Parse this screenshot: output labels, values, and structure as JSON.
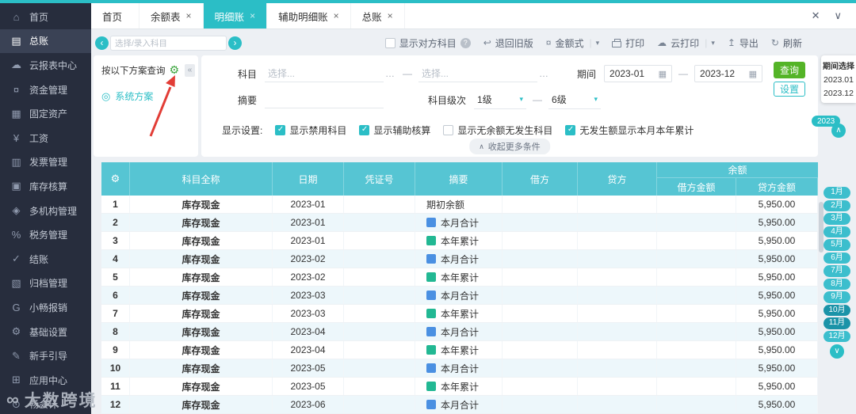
{
  "window": {
    "close_icon": "✕",
    "collapse_icon": "∨"
  },
  "tabs": {
    "items": [
      {
        "label": "首页",
        "close": "",
        "cls": "tab"
      },
      {
        "label": "余额表",
        "close": "×",
        "cls": "tab"
      },
      {
        "label": "明细账",
        "close": "×",
        "cls": "tab active"
      },
      {
        "label": "辅助明细账",
        "close": "×",
        "cls": "tab"
      },
      {
        "label": "总账",
        "close": "×",
        "cls": "tab"
      }
    ]
  },
  "sidebar": {
    "items": [
      {
        "label": "首页",
        "icon": "home-icon",
        "glyph": "⌂",
        "cls": "side-item"
      },
      {
        "label": "总账",
        "icon": "general-ledger-icon",
        "glyph": "▤",
        "cls": "side-item active"
      },
      {
        "label": "云报表中心",
        "icon": "cloud-report-icon",
        "glyph": "☁",
        "cls": "side-item"
      },
      {
        "label": "资金管理",
        "icon": "funds-icon",
        "glyph": "¤",
        "cls": "side-item"
      },
      {
        "label": "固定资产",
        "icon": "fixed-assets-icon",
        "glyph": "▦",
        "cls": "side-item"
      },
      {
        "label": "工资",
        "icon": "salary-icon",
        "glyph": "¥",
        "cls": "side-item"
      },
      {
        "label": "发票管理",
        "icon": "invoice-icon",
        "glyph": "▥",
        "cls": "side-item"
      },
      {
        "label": "库存核算",
        "icon": "inventory-icon",
        "glyph": "▣",
        "cls": "side-item"
      },
      {
        "label": "多机构管理",
        "icon": "multi-org-icon",
        "glyph": "◈",
        "cls": "side-item"
      },
      {
        "label": "税务管理",
        "icon": "tax-icon",
        "glyph": "%",
        "cls": "side-item"
      },
      {
        "label": "结账",
        "icon": "closing-icon",
        "glyph": "✓",
        "cls": "side-item"
      },
      {
        "label": "归档管理",
        "icon": "archive-icon",
        "glyph": "▧",
        "cls": "side-item"
      },
      {
        "label": "小畅报销",
        "icon": "reimburse-icon",
        "glyph": "G",
        "cls": "side-item"
      },
      {
        "label": "基础设置",
        "icon": "settings-icon",
        "glyph": "⚙",
        "cls": "side-item"
      },
      {
        "label": "新手引导",
        "icon": "guide-icon",
        "glyph": "✎",
        "cls": "side-item"
      },
      {
        "label": "应用中心",
        "icon": "app-center-icon",
        "glyph": "⊞",
        "cls": "side-item"
      },
      {
        "label": "畅会计",
        "icon": "accounting-icon",
        "glyph": "⊙",
        "cls": "side-item"
      }
    ]
  },
  "subject_search": {
    "prev": "‹",
    "next": "›",
    "placeholder": "选择/录入科目"
  },
  "toolbar": {
    "show_opposite": {
      "checked": false,
      "label": "显示对方科目",
      "help": "?"
    },
    "separator": "|",
    "caret": "▾",
    "items": [
      {
        "glyph": "↩",
        "label": "退回旧版"
      },
      {
        "glyph": "¤",
        "label": "金额式"
      },
      {
        "glyph": "",
        "label": "打印"
      },
      {
        "glyph": "☁",
        "label": "云打印"
      },
      {
        "glyph": "↥",
        "label": "导出"
      },
      {
        "glyph": "↻",
        "label": "刷新"
      }
    ]
  },
  "scheme": {
    "title": "按以下方案查询",
    "gear": "⚙",
    "collapse": "«",
    "item_icon": "◎",
    "item": "系统方案"
  },
  "filters": {
    "subject_label": "科目",
    "placeholder_from": "选择...",
    "placeholder_to": "选择...",
    "more": "…",
    "dash": "—",
    "period_label": "期间",
    "period_from": "2023-01",
    "period_to": "2023-12",
    "calendar": "▦",
    "summary_label": "摘要",
    "level_label": "科目级次",
    "level_from": "1级",
    "level_to": "6级",
    "caret": "▾",
    "query_btn": "查询",
    "settings_btn": "设置",
    "display_label": "显示设置:",
    "checks": [
      {
        "label": "显示禁用科目",
        "checked": true
      },
      {
        "label": "显示辅助核算",
        "checked": true
      },
      {
        "label": "显示无余额无发生科目",
        "checked": false
      },
      {
        "label": "无发生额显示本月本年累计",
        "checked": true
      }
    ],
    "collapse_icon": "∧",
    "collapse_more": "收起更多条件"
  },
  "period": {
    "title": "期间选择",
    "from": "2023.01",
    "to": "2023.12",
    "year": "2023",
    "up": "∧",
    "down": "∨",
    "months": [
      {
        "label": "1月",
        "cls": "month-pill"
      },
      {
        "label": "2月",
        "cls": "month-pill"
      },
      {
        "label": "3月",
        "cls": "month-pill"
      },
      {
        "label": "4月",
        "cls": "month-pill"
      },
      {
        "label": "5月",
        "cls": "month-pill"
      },
      {
        "label": "6月",
        "cls": "month-pill"
      },
      {
        "label": "7月",
        "cls": "month-pill"
      },
      {
        "label": "8月",
        "cls": "month-pill"
      },
      {
        "label": "9月",
        "cls": "month-pill"
      },
      {
        "label": "10月",
        "cls": "month-pill dark"
      },
      {
        "label": "11月",
        "cls": "month-pill dark"
      },
      {
        "label": "12月",
        "cls": "month-pill"
      }
    ]
  },
  "table": {
    "gear": "⚙",
    "headers": {
      "subject": "科目全称",
      "date": "日期",
      "voucher": "凭证号",
      "summary": "摘要",
      "debit": "借方",
      "credit": "贷方",
      "balance": "余额",
      "balance_debit": "借方金额",
      "balance_credit": "贷方金额"
    },
    "rows": [
      {
        "n": "1",
        "subject": "库存现金",
        "date": "2023-01",
        "voucher": "",
        "summary": "期初余额",
        "icon": "none",
        "debit": "",
        "credit": "",
        "bal_debit": "",
        "bal_credit": "5,950.00"
      },
      {
        "n": "2",
        "subject": "库存现金",
        "date": "2023-01",
        "voucher": "",
        "summary": "本月合计",
        "icon": "month",
        "debit": "",
        "credit": "",
        "bal_debit": "",
        "bal_credit": "5,950.00"
      },
      {
        "n": "3",
        "subject": "库存现金",
        "date": "2023-01",
        "voucher": "",
        "summary": "本年累计",
        "icon": "year",
        "debit": "",
        "credit": "",
        "bal_debit": "",
        "bal_credit": "5,950.00"
      },
      {
        "n": "4",
        "subject": "库存现金",
        "date": "2023-02",
        "voucher": "",
        "summary": "本月合计",
        "icon": "month",
        "debit": "",
        "credit": "",
        "bal_debit": "",
        "bal_credit": "5,950.00"
      },
      {
        "n": "5",
        "subject": "库存现金",
        "date": "2023-02",
        "voucher": "",
        "summary": "本年累计",
        "icon": "year",
        "debit": "",
        "credit": "",
        "bal_debit": "",
        "bal_credit": "5,950.00"
      },
      {
        "n": "6",
        "subject": "库存现金",
        "date": "2023-03",
        "voucher": "",
        "summary": "本月合计",
        "icon": "month",
        "debit": "",
        "credit": "",
        "bal_debit": "",
        "bal_credit": "5,950.00"
      },
      {
        "n": "7",
        "subject": "库存现金",
        "date": "2023-03",
        "voucher": "",
        "summary": "本年累计",
        "icon": "year",
        "debit": "",
        "credit": "",
        "bal_debit": "",
        "bal_credit": "5,950.00"
      },
      {
        "n": "8",
        "subject": "库存现金",
        "date": "2023-04",
        "voucher": "",
        "summary": "本月合计",
        "icon": "month",
        "debit": "",
        "credit": "",
        "bal_debit": "",
        "bal_credit": "5,950.00"
      },
      {
        "n": "9",
        "subject": "库存现金",
        "date": "2023-04",
        "voucher": "",
        "summary": "本年累计",
        "icon": "year",
        "debit": "",
        "credit": "",
        "bal_debit": "",
        "bal_credit": "5,950.00"
      },
      {
        "n": "10",
        "subject": "库存现金",
        "date": "2023-05",
        "voucher": "",
        "summary": "本月合计",
        "icon": "month",
        "debit": "",
        "credit": "",
        "bal_debit": "",
        "bal_credit": "5,950.00"
      },
      {
        "n": "11",
        "subject": "库存现金",
        "date": "2023-05",
        "voucher": "",
        "summary": "本年累计",
        "icon": "year",
        "debit": "",
        "credit": "",
        "bal_debit": "",
        "bal_credit": "5,950.00"
      },
      {
        "n": "12",
        "subject": "库存现金",
        "date": "2023-06",
        "voucher": "",
        "summary": "本月合计",
        "icon": "month",
        "debit": "",
        "credit": "",
        "bal_debit": "",
        "bal_credit": "5,950.00"
      }
    ]
  },
  "watermark": {
    "logo": "∞",
    "text": "大数跨境"
  }
}
